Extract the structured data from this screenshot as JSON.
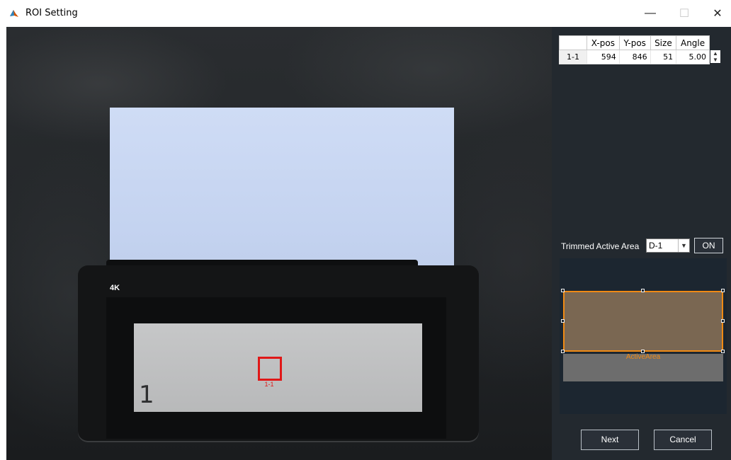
{
  "window": {
    "title": "ROI Setting",
    "minimize_glyph": "—",
    "maximize_glyph": "☐",
    "close_glyph": "✕",
    "icon": "matlab-icon"
  },
  "viewer": {
    "monitor_badge": "4K",
    "screen_number": "1",
    "roi_label": "1-1",
    "roi_color": "#e01818"
  },
  "roi_table": {
    "columns": [
      "",
      "X-pos",
      "Y-pos",
      "Size",
      "Angle"
    ],
    "rows": [
      {
        "id": "1-1",
        "x_pos": "594",
        "y_pos": "846",
        "size": "51",
        "angle": "5.00"
      }
    ]
  },
  "trim": {
    "label": "Trimmed Active Area",
    "selected": "D-1",
    "toggle_label": "ON"
  },
  "area_preview": {
    "active_label": "ActiveArea",
    "accent": "#f08a14"
  },
  "buttons": {
    "next": "Next",
    "cancel": "Cancel"
  }
}
